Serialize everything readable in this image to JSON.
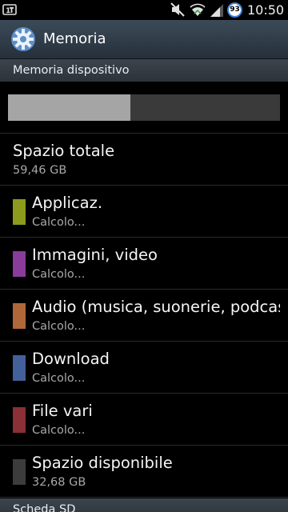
{
  "status_bar": {
    "time": "10:50",
    "battery_level": "93",
    "icons": [
      "notification-icon",
      "mute-icon",
      "wifi-icon",
      "signal-icon"
    ]
  },
  "action_bar": {
    "title": "Memoria",
    "icon": "settings-gear-icon"
  },
  "device_section": {
    "header": "Memoria dispositivo",
    "usage_fraction": 0.45,
    "colors": {
      "used": "#a5a5a5",
      "free": "#3a3a3a"
    }
  },
  "total": {
    "title": "Spazio totale",
    "value": "59,46 GB"
  },
  "items": [
    {
      "title": "Applicaz.",
      "sub": "Calcolo...",
      "color": "#8c9a1e"
    },
    {
      "title": "Immagini, video",
      "sub": "Calcolo...",
      "color": "#8a3c9a"
    },
    {
      "title": "Audio (musica, suonerie, podcast)",
      "sub": "Calcolo...",
      "color": "#b0683a"
    },
    {
      "title": "Download",
      "sub": "Calcolo...",
      "color": "#44609a"
    },
    {
      "title": "File vari",
      "sub": "Calcolo...",
      "color": "#8a3036"
    },
    {
      "title": "Spazio disponibile",
      "sub": "32,68 GB",
      "color": "#3c3c3c"
    }
  ],
  "sd_section": {
    "header": "Scheda SD"
  }
}
